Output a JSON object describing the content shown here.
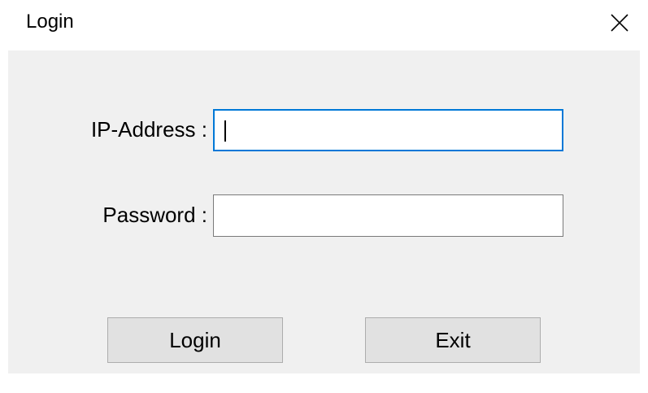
{
  "window": {
    "title": "Login",
    "close_icon": "close-icon"
  },
  "form": {
    "ip_label": "IP-Address :",
    "ip_value": "",
    "ip_placeholder": "",
    "password_label": "Password :",
    "password_value": "",
    "password_placeholder": ""
  },
  "buttons": {
    "login_label": "Login",
    "exit_label": "Exit"
  },
  "colors": {
    "focus_border": "#0078d7",
    "client_background": "#f0f0f0",
    "button_background": "#e1e1e1"
  }
}
